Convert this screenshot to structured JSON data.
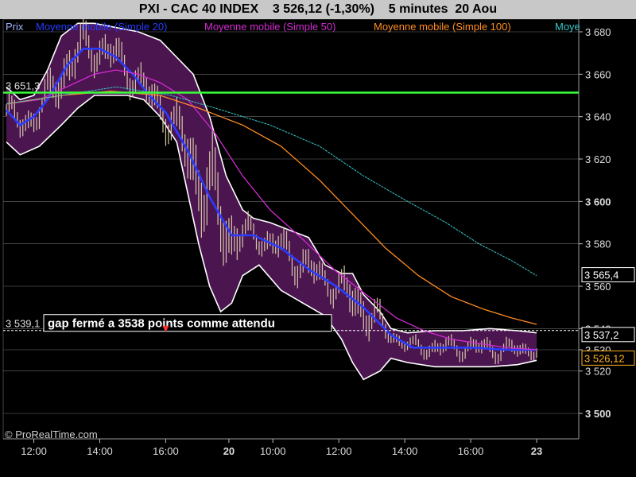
{
  "header": {
    "title": "PXI - CAC 40 INDEX    3 526,12 (-1,30%)    5 minutes  20 Aou"
  },
  "legend": [
    {
      "label": "Prix",
      "color": "#9fb4ff"
    },
    {
      "label": "Moyenne mobile (Simple 20)",
      "color": "#2a3cff"
    },
    {
      "label": "Moyenne mobile (Simple 50)",
      "color": "#d22bd2"
    },
    {
      "label": "Moyenne mobile (Simple 100)",
      "color": "#ff8c22"
    },
    {
      "label": "Moye",
      "color": "#39c6c6"
    }
  ],
  "annotation": "gap  fermé a 3538 points comme attendu",
  "copyright": "© ProRealTime.com",
  "colors": {
    "background": "#000000",
    "band_fill": "#4b1550",
    "band_edge": "#ffffff",
    "candles": "#d8c8a8",
    "level_line": "#39ff39",
    "dashed_line": "#ffffff",
    "grid": "#6e6e6e"
  },
  "chart_data": {
    "type": "line",
    "title": "PXI - CAC 40 INDEX    3 526,12 (-1,30%)    5 minutes  20 Aou",
    "ylim": [
      3488,
      3686
    ],
    "y_ticks": [
      {
        "value": 3680,
        "label": "3 680",
        "bold": false
      },
      {
        "value": 3660,
        "label": "3 660",
        "bold": false
      },
      {
        "value": 3640,
        "label": "3 640",
        "bold": false
      },
      {
        "value": 3620,
        "label": "3 620",
        "bold": false
      },
      {
        "value": 3600,
        "label": "3 600",
        "bold": true
      },
      {
        "value": 3580,
        "label": "3 580",
        "bold": false
      },
      {
        "value": 3560,
        "label": "3 560",
        "bold": false
      },
      {
        "value": 3540,
        "label": "3 540",
        "bold": false
      },
      {
        "value": 3530,
        "label": "3 530",
        "bold": false
      },
      {
        "value": 3520,
        "label": "3 520",
        "bold": false
      },
      {
        "value": 3500,
        "label": "3 500",
        "bold": true
      }
    ],
    "x_ticks": [
      {
        "label": "12:00",
        "bold": false
      },
      {
        "label": "14:00",
        "bold": false
      },
      {
        "label": "16:00",
        "bold": false
      },
      {
        "label": "20",
        "bold": true
      },
      {
        "label": "10:00",
        "bold": false
      },
      {
        "label": "12:00",
        "bold": false
      },
      {
        "label": "14:00",
        "bold": false
      },
      {
        "label": "16:00",
        "bold": false
      },
      {
        "label": "23",
        "bold": true
      }
    ],
    "x_tick_index": [
      10,
      34,
      58,
      81,
      97,
      121,
      145,
      169,
      193
    ],
    "n_bars": 193,
    "horizontal_levels": [
      {
        "name": "level-line",
        "value": 3651.3,
        "label": "3 651,3",
        "color": "#39ff39"
      },
      {
        "name": "gap-line",
        "value": 3539.1,
        "label": "3 539,1",
        "color": "#ffffff",
        "dashed": true
      }
    ],
    "price_tags": [
      {
        "value": 3565.4,
        "label": "3 565,4",
        "color": "#ffffff"
      },
      {
        "value": 3537.2,
        "label": "3 537,2",
        "color": "#ffffff"
      },
      {
        "value": 3526.12,
        "label": "3 526,12",
        "color": "#ffb020"
      }
    ],
    "series": [
      {
        "name": "Moyenne mobile (Simple 20)",
        "color": "#2a3cff",
        "points": [
          [
            0,
            3643
          ],
          [
            5,
            3636
          ],
          [
            10,
            3640
          ],
          [
            15,
            3648
          ],
          [
            22,
            3664
          ],
          [
            28,
            3672
          ],
          [
            34,
            3672
          ],
          [
            40,
            3668
          ],
          [
            46,
            3660
          ],
          [
            52,
            3650
          ],
          [
            58,
            3642
          ],
          [
            66,
            3624
          ],
          [
            74,
            3602
          ],
          [
            82,
            3584
          ],
          [
            90,
            3584
          ],
          [
            100,
            3578
          ],
          [
            110,
            3568
          ],
          [
            120,
            3560
          ],
          [
            130,
            3550
          ],
          [
            140,
            3537
          ],
          [
            148,
            3531
          ],
          [
            158,
            3531
          ],
          [
            170,
            3531
          ],
          [
            182,
            3530
          ],
          [
            193,
            3530
          ]
        ]
      },
      {
        "name": "Moyenne mobile (Simple 50)",
        "color": "#d22bd2",
        "points": [
          [
            0,
            3646
          ],
          [
            12,
            3648
          ],
          [
            22,
            3654
          ],
          [
            32,
            3660
          ],
          [
            40,
            3662
          ],
          [
            48,
            3660
          ],
          [
            56,
            3656
          ],
          [
            66,
            3648
          ],
          [
            76,
            3632
          ],
          [
            86,
            3612
          ],
          [
            96,
            3596
          ],
          [
            108,
            3582
          ],
          [
            120,
            3567
          ],
          [
            132,
            3555
          ],
          [
            142,
            3545
          ],
          [
            152,
            3539
          ],
          [
            162,
            3535
          ],
          [
            172,
            3533
          ],
          [
            182,
            3531
          ],
          [
            193,
            3530
          ]
        ]
      },
      {
        "name": "Moyenne mobile (Simple 100)",
        "color": "#ff8c22",
        "points": [
          [
            0,
            3646
          ],
          [
            20,
            3650
          ],
          [
            38,
            3652
          ],
          [
            56,
            3650
          ],
          [
            70,
            3644
          ],
          [
            86,
            3636
          ],
          [
            100,
            3626
          ],
          [
            114,
            3610
          ],
          [
            126,
            3594
          ],
          [
            138,
            3578
          ],
          [
            150,
            3565
          ],
          [
            162,
            3555
          ],
          [
            174,
            3549
          ],
          [
            184,
            3545
          ],
          [
            193,
            3542
          ]
        ]
      },
      {
        "name": "Moye",
        "color": "#39c6c6",
        "points": [
          [
            0,
            3646
          ],
          [
            20,
            3650
          ],
          [
            40,
            3654
          ],
          [
            60,
            3650
          ],
          [
            76,
            3644
          ],
          [
            96,
            3636
          ],
          [
            114,
            3626
          ],
          [
            130,
            3612
          ],
          [
            146,
            3600
          ],
          [
            160,
            3590
          ],
          [
            172,
            3580
          ],
          [
            184,
            3572
          ],
          [
            193,
            3565
          ]
        ]
      }
    ],
    "bands": {
      "name": "bollinger-band",
      "upper": [
        [
          0,
          3654
        ],
        [
          5,
          3648
        ],
        [
          10,
          3650
        ],
        [
          15,
          3662
        ],
        [
          20,
          3678
        ],
        [
          26,
          3684
        ],
        [
          32,
          3684
        ],
        [
          40,
          3682
        ],
        [
          48,
          3680
        ],
        [
          56,
          3676
        ],
        [
          62,
          3668
        ],
        [
          68,
          3660
        ],
        [
          74,
          3640
        ],
        [
          80,
          3612
        ],
        [
          86,
          3596
        ],
        [
          90,
          3592
        ],
        [
          96,
          3590
        ],
        [
          104,
          3586
        ],
        [
          110,
          3583
        ],
        [
          116,
          3570
        ],
        [
          122,
          3566
        ],
        [
          126,
          3566
        ],
        [
          130,
          3556
        ],
        [
          136,
          3548
        ],
        [
          140,
          3540
        ],
        [
          146,
          3538
        ],
        [
          156,
          3539
        ],
        [
          166,
          3539
        ],
        [
          176,
          3540
        ],
        [
          186,
          3539
        ],
        [
          193,
          3538
        ]
      ],
      "lower": [
        [
          0,
          3628
        ],
        [
          5,
          3622
        ],
        [
          12,
          3626
        ],
        [
          20,
          3636
        ],
        [
          26,
          3644
        ],
        [
          32,
          3650
        ],
        [
          38,
          3650
        ],
        [
          44,
          3650
        ],
        [
          50,
          3648
        ],
        [
          56,
          3640
        ],
        [
          62,
          3628
        ],
        [
          66,
          3604
        ],
        [
          70,
          3580
        ],
        [
          74,
          3560
        ],
        [
          78,
          3548
        ],
        [
          82,
          3552
        ],
        [
          86,
          3565
        ],
        [
          92,
          3570
        ],
        [
          100,
          3558
        ],
        [
          108,
          3552
        ],
        [
          116,
          3546
        ],
        [
          122,
          3535
        ],
        [
          126,
          3524
        ],
        [
          130,
          3516
        ],
        [
          136,
          3520
        ],
        [
          140,
          3526
        ],
        [
          146,
          3524
        ],
        [
          156,
          3522
        ],
        [
          166,
          3522
        ],
        [
          176,
          3522
        ],
        [
          186,
          3523
        ],
        [
          193,
          3525
        ]
      ]
    }
  }
}
